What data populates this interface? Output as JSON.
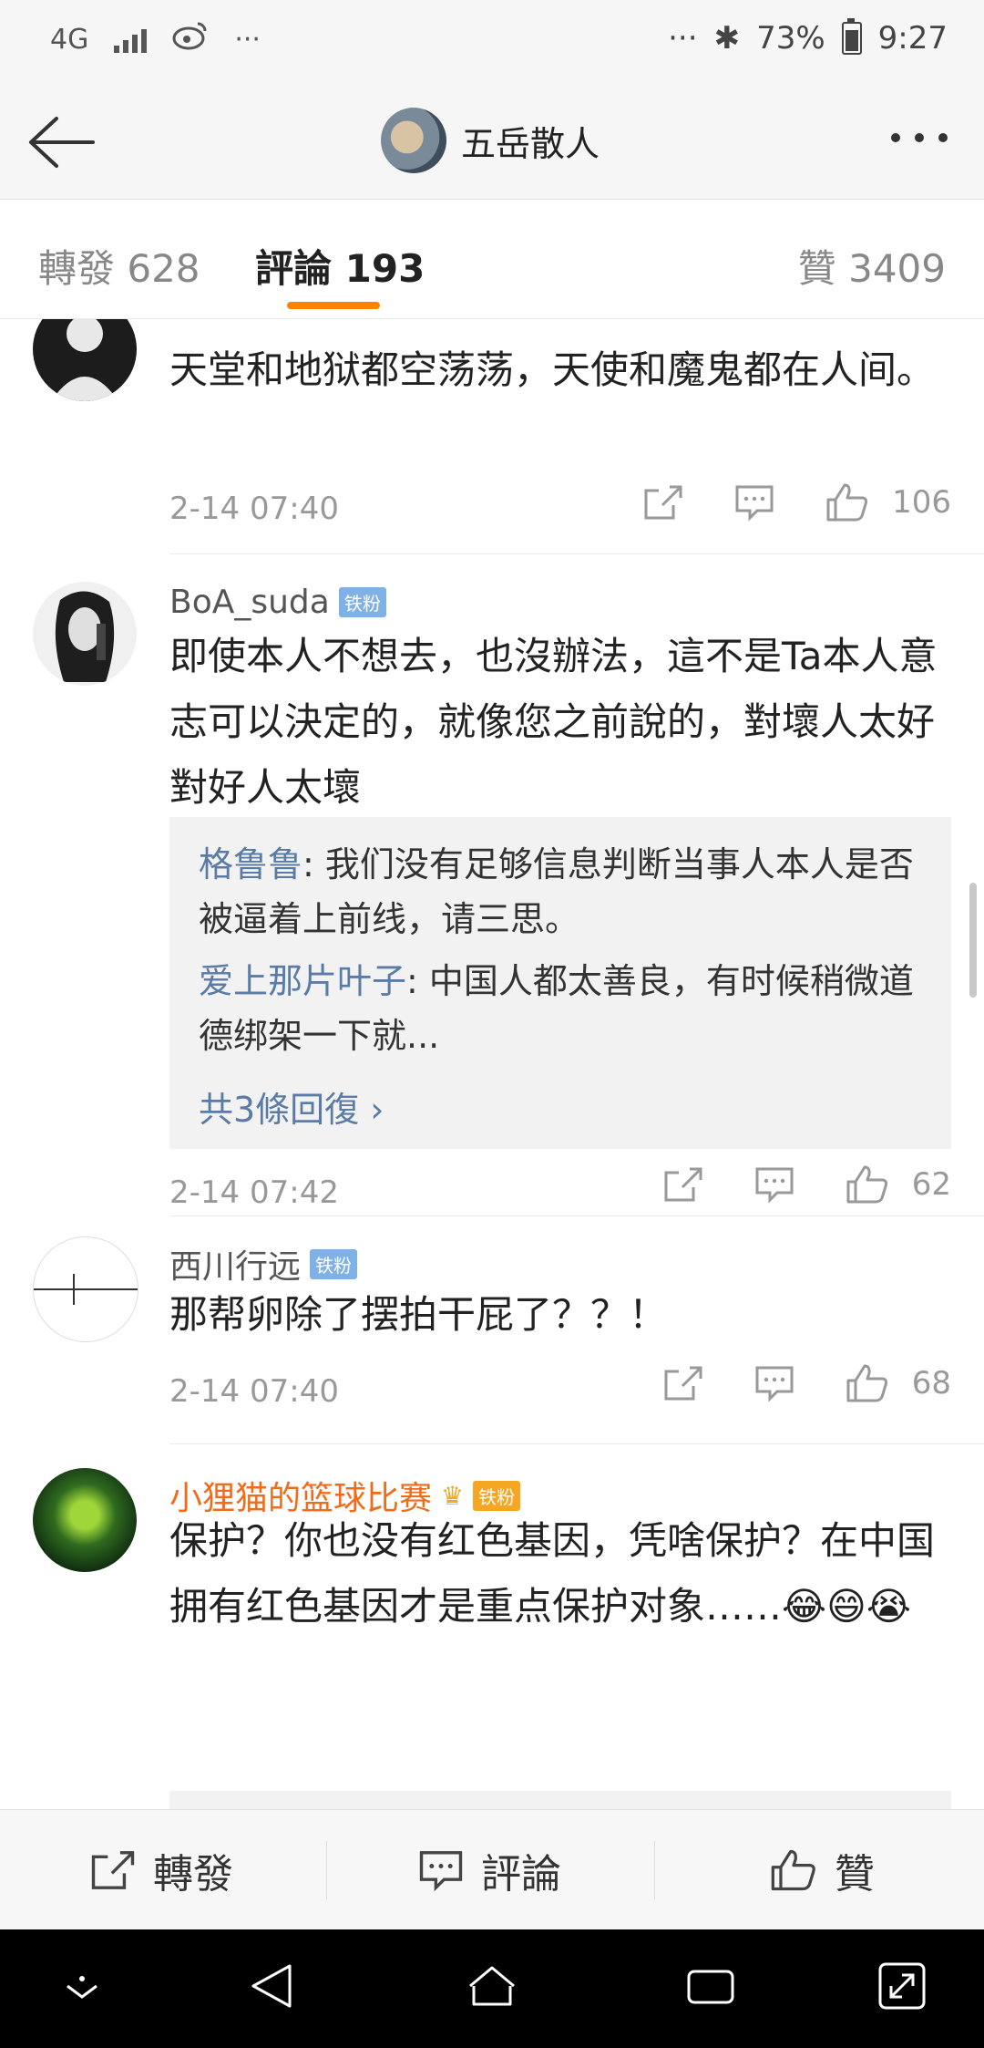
{
  "status_bar": {
    "network": "4G",
    "dots_left": "···",
    "dots_right": "···",
    "bluetooth": "✱",
    "battery": "73%",
    "time": "9:27"
  },
  "header": {
    "title": "五岳散人"
  },
  "tabs": [
    {
      "label": "轉發 628"
    },
    {
      "label": "評論 193"
    },
    {
      "label": "贊 3409"
    }
  ],
  "comments": [
    {
      "name": "",
      "text": "天堂和地狱都空荡荡，天使和魔鬼都在人间。",
      "time": "2-14 07:40",
      "likes": "106"
    },
    {
      "name": "BoA_suda",
      "badge": "铁粉",
      "text": "即使本人不想去，也沒辦法，這不是Ta本人意志可以決定的，就像您之前說的，對壞人太好對好人太壞",
      "replies": [
        {
          "name": "格鲁鲁",
          "text": ": 我们没有足够信息判断当事人本人是否被逼着上前线，请三思。"
        },
        {
          "name": "爱上那片叶子",
          "text": ": 中国人都太善良，有时候稍微道德绑架一下就..."
        }
      ],
      "more_replies": "共3條回復 ›",
      "time": "2-14 07:42",
      "likes": "62"
    },
    {
      "name": "西川行远",
      "badge": "铁粉",
      "text": "那帮卵除了摆拍干屁了？？！",
      "time": "2-14 07:40",
      "likes": "68"
    },
    {
      "name": "小狸猫的篮球比赛",
      "badge": "铁粉",
      "text": "保护？你也没有红色基因，凭啥保护？在中国拥有红色基因才是重点保护对象……😂😄😭"
    }
  ],
  "bottom_bar": {
    "repost": "轉發",
    "comment": "評論",
    "like": "贊"
  },
  "colors": {
    "accent": "#ff8200",
    "link": "#5a7ba6",
    "vip_name": "#f06b1a"
  }
}
